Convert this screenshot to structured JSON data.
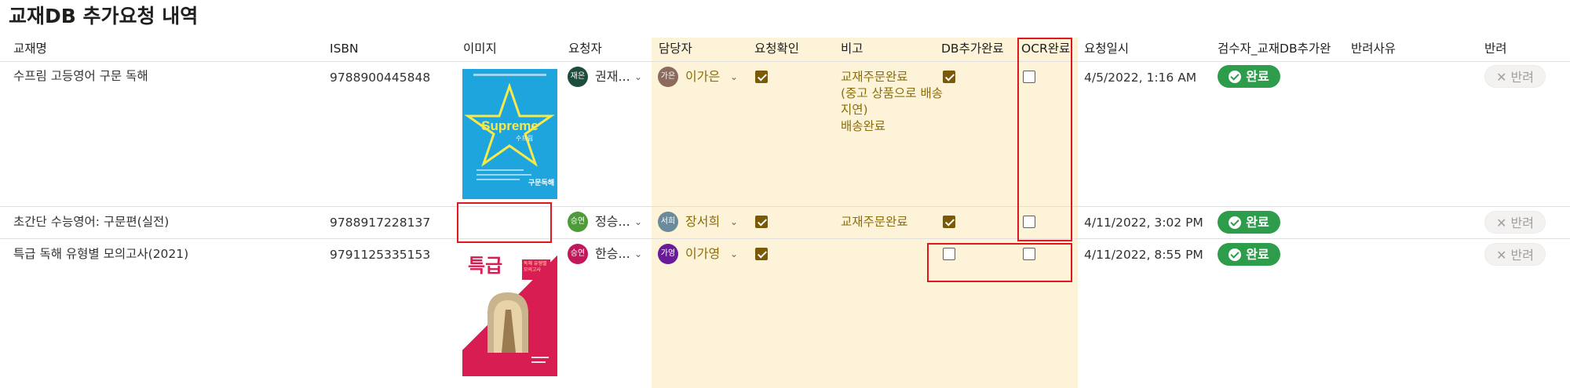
{
  "page_title": "교재DB 추가요청 내역",
  "columns": {
    "title": "교재명",
    "isbn": "ISBN",
    "image": "이미지",
    "requester": "요청자",
    "assignee": "담당자",
    "confirm": "요청확인",
    "note": "비고",
    "db_done": "DB추가완료",
    "ocr_done": "OCR완료",
    "requested_at": "요청일시",
    "reviewer": "검수자_교재DB추가완",
    "reject_reason": "반려사유",
    "reject": "반려"
  },
  "rows": [
    {
      "title": "수프림 고등영어 구문 독해",
      "isbn": "9788900445848",
      "image": {
        "cover_title": "Supreme",
        "cover_sub": "수프림",
        "cover_tag": "구문독해"
      },
      "requester": {
        "initials": "재은",
        "name": "권재...",
        "color": "#1d4d3b"
      },
      "assignee": {
        "initials": "가은",
        "name": "이가은",
        "color": "#8c6a5c"
      },
      "confirm": true,
      "note": "교재주문완료\n(중고 상품으로 배송 지연)\n배송완료",
      "db_done": true,
      "ocr_done": false,
      "requested_at": "4/5/2022, 1:16 AM",
      "status_label": "완료",
      "reject_label": "반려"
    },
    {
      "title": "초간단 수능영어: 구문편(실전)",
      "isbn": "9788917228137",
      "requester": {
        "initials": "승연",
        "name": "정승...",
        "color": "#4f9a3a"
      },
      "assignee": {
        "initials": "서희",
        "name": "장서희",
        "color": "#6b8a9b"
      },
      "confirm": true,
      "note": "교재주문완료",
      "db_done": true,
      "ocr_done": false,
      "requested_at": "4/11/2022, 3:02 PM",
      "status_label": "완료",
      "reject_label": "반려"
    },
    {
      "title": "특급 독해 유형별 모의고사(2021)",
      "isbn": "9791125335153",
      "image": {
        "cover_title": "특급",
        "cover_badge": "독해 유형별 모의고사"
      },
      "requester": {
        "initials": "승연",
        "name": "한승...",
        "color": "#c2185b"
      },
      "assignee": {
        "initials": "가영",
        "name": "이가영",
        "color": "#6a1b9a"
      },
      "confirm": true,
      "note": "",
      "db_done": false,
      "ocr_done": false,
      "requested_at": "4/11/2022, 8:55 PM",
      "status_label": "완료",
      "reject_label": "반려"
    }
  ],
  "colors": {
    "accent_band": "#fdf3d8",
    "checkbox_checked": "#7a5a06",
    "done_green": "#2e9d4b",
    "annotation_red": "#e0171f",
    "note_text": "#8a6d0c"
  },
  "icons": {
    "chevron": "chevron-down-icon",
    "check_circle": "check-circle-icon",
    "close": "close-icon"
  }
}
